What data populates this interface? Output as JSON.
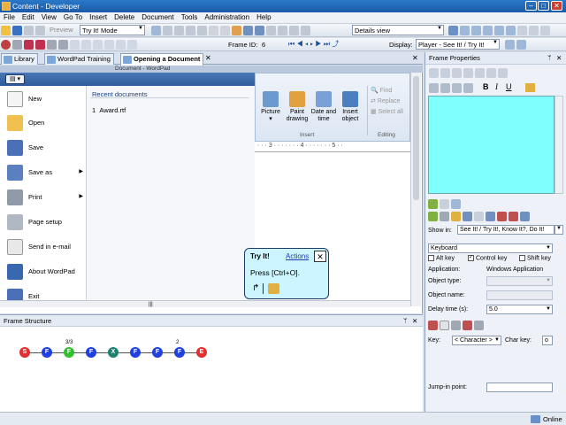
{
  "window": {
    "title": "Content - Developer"
  },
  "menu": [
    "File",
    "Edit",
    "View",
    "Go To",
    "Insert",
    "Delete",
    "Document",
    "Tools",
    "Administration",
    "Help"
  ],
  "toolbar1": {
    "preview_label": "Preview",
    "mode_value": "Try It! Mode",
    "view_value": "Details view"
  },
  "toolbar2": {
    "frame_id_label": "Frame ID:",
    "frame_id_value": "6",
    "display_label": "Display:",
    "display_value": "Player - See It! / Try It!"
  },
  "tabs": [
    "Library",
    "WordPad Training",
    "Opening a Document"
  ],
  "wordpad": {
    "title": "Document - WordPad",
    "menu_items": [
      "New",
      "Open",
      "Save",
      "Save as",
      "Print",
      "Page setup",
      "Send in e-mail",
      "About WordPad",
      "Exit"
    ],
    "recent_header": "Recent documents",
    "recent": [
      {
        "num": "1",
        "name": "Award.rtf"
      }
    ],
    "ribbon": {
      "insert_buttons": [
        "Picture",
        "Paint drawing",
        "Date and time",
        "Insert object"
      ],
      "picture_sub": "▾",
      "insert_group": "Insert",
      "editing_buttons": [
        "Find",
        "Replace",
        "Select all"
      ],
      "editing_group": "Editing"
    },
    "ruler": "· · · 3 · · · · · · · 4 · · · · · · · 5 · ·"
  },
  "tryit": {
    "title": "Try It!",
    "actions": "Actions",
    "instruction": "Press [Ctrl+O].",
    "close": "✕"
  },
  "frame_structure": {
    "title": "Frame Structure",
    "nodes": [
      {
        "label": "S",
        "color": "#e03030"
      },
      {
        "label": "F",
        "color": "#2040e0"
      },
      {
        "label": "F",
        "color": "#30c030",
        "note": "3/3"
      },
      {
        "label": "F",
        "color": "#2040e0"
      },
      {
        "label": "X",
        "color": "#208070"
      },
      {
        "label": "F",
        "color": "#2040e0"
      },
      {
        "label": "F",
        "color": "#2040e0"
      },
      {
        "label": "F",
        "color": "#2040e0",
        "note": "2"
      },
      {
        "label": "E",
        "color": "#e03030"
      }
    ]
  },
  "frame_properties": {
    "title": "Frame Properties",
    "show_in_label": "Show in:",
    "show_in_value": "See It! / Try It!, Know It?, Do It!",
    "action_type": "Keyboard",
    "alt_key": "Alt key",
    "control_key": "Control key",
    "shift_key": "Shift key",
    "application_label": "Application:",
    "application_value": "Windows Application",
    "object_type_label": "Object type:",
    "object_name_label": "Object name:",
    "delay_label": "Delay time (s):",
    "delay_value": "5.0",
    "key_label": "Key:",
    "key_value": "< Character >",
    "char_key_label": "Char key:",
    "char_key_value": "o",
    "jump_label": "Jump-in point:"
  },
  "status": {
    "online": "Online"
  }
}
